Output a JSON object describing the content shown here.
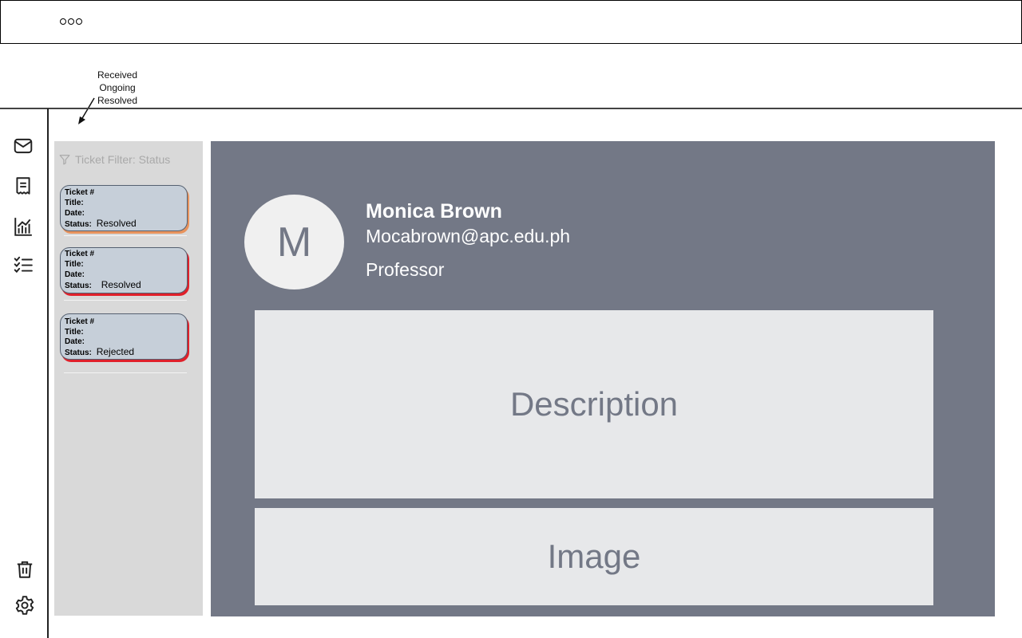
{
  "annotation": {
    "lines": [
      "Received",
      "Ongoing",
      "Resolved"
    ]
  },
  "sidebar": {
    "icons": [
      "mail-icon",
      "receipt-icon",
      "analytics-icon",
      "checklist-icon",
      "trash-icon",
      "gear-icon"
    ]
  },
  "ticket_panel": {
    "filter_label": "Ticket Filter: Status",
    "field_labels": {
      "ticket": "Ticket #",
      "title": "Title:",
      "date": "Date:",
      "status": "Status:"
    },
    "tickets": [
      {
        "status": "Resolved",
        "accent": "#e8935d"
      },
      {
        "status": "Resolved",
        "accent": "#e0202a"
      },
      {
        "status": "Rejected",
        "accent": "#e0202a"
      }
    ]
  },
  "detail": {
    "avatar_initial": "M",
    "name": "Monica Brown",
    "email": "Mocabrown@apc.edu.ph",
    "role": "Professor",
    "description_label": "Description",
    "image_label": "Image"
  },
  "colors": {
    "panel_bg": "#d9d9d9",
    "detail_bg": "#737886",
    "ticket_bg": "#c6cfd9"
  }
}
